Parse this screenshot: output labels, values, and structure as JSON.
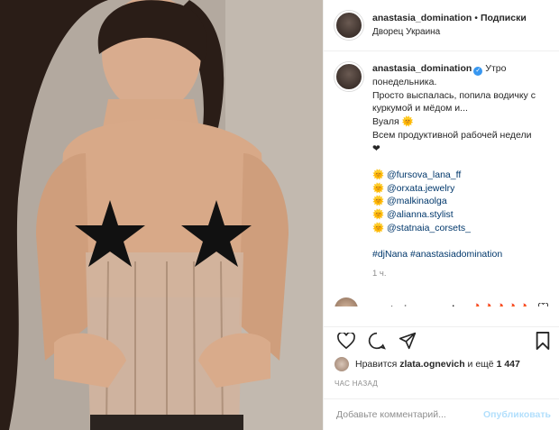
{
  "header": {
    "username": "anastasia_domination",
    "separator": "•",
    "follow_label": "Подписки",
    "location": "Дворец Украина"
  },
  "caption": {
    "username": "anastasia_domination",
    "lines": [
      "Утро",
      "понедельника.",
      "Просто выспалась, попила водичку с",
      "куркумой и мёдом и...",
      "Вуаля 🌞",
      "Всем продуктивной рабочей недели",
      "❤"
    ],
    "mentions": [
      "🌞 @fursova_lana_ff",
      "🌞 @orxata.jewelry",
      "🌞 @malkinaolga",
      "🌞 @alianna.stylist",
      "🌞 @statnaia_corsets_"
    ],
    "hashtags": "#djNana #anastasiadomination",
    "age": "1 ч."
  },
  "comment": {
    "username": "anastasiaromanenkoo",
    "text": "🔥🔥🔥🔥🔥"
  },
  "likes": {
    "prefix": "Нравится",
    "user": "zlata.ognevich",
    "middle": "и ещё",
    "count": "1 447"
  },
  "timestamp": "ЧАС НАЗАД",
  "add_comment": {
    "placeholder": "Добавьте комментарий...",
    "post_label": "Опубликовать"
  },
  "colors": {
    "link": "#00376b",
    "verified": "#3897f0",
    "post_disabled": "#b2dffc",
    "muted": "#8e8e8e"
  }
}
